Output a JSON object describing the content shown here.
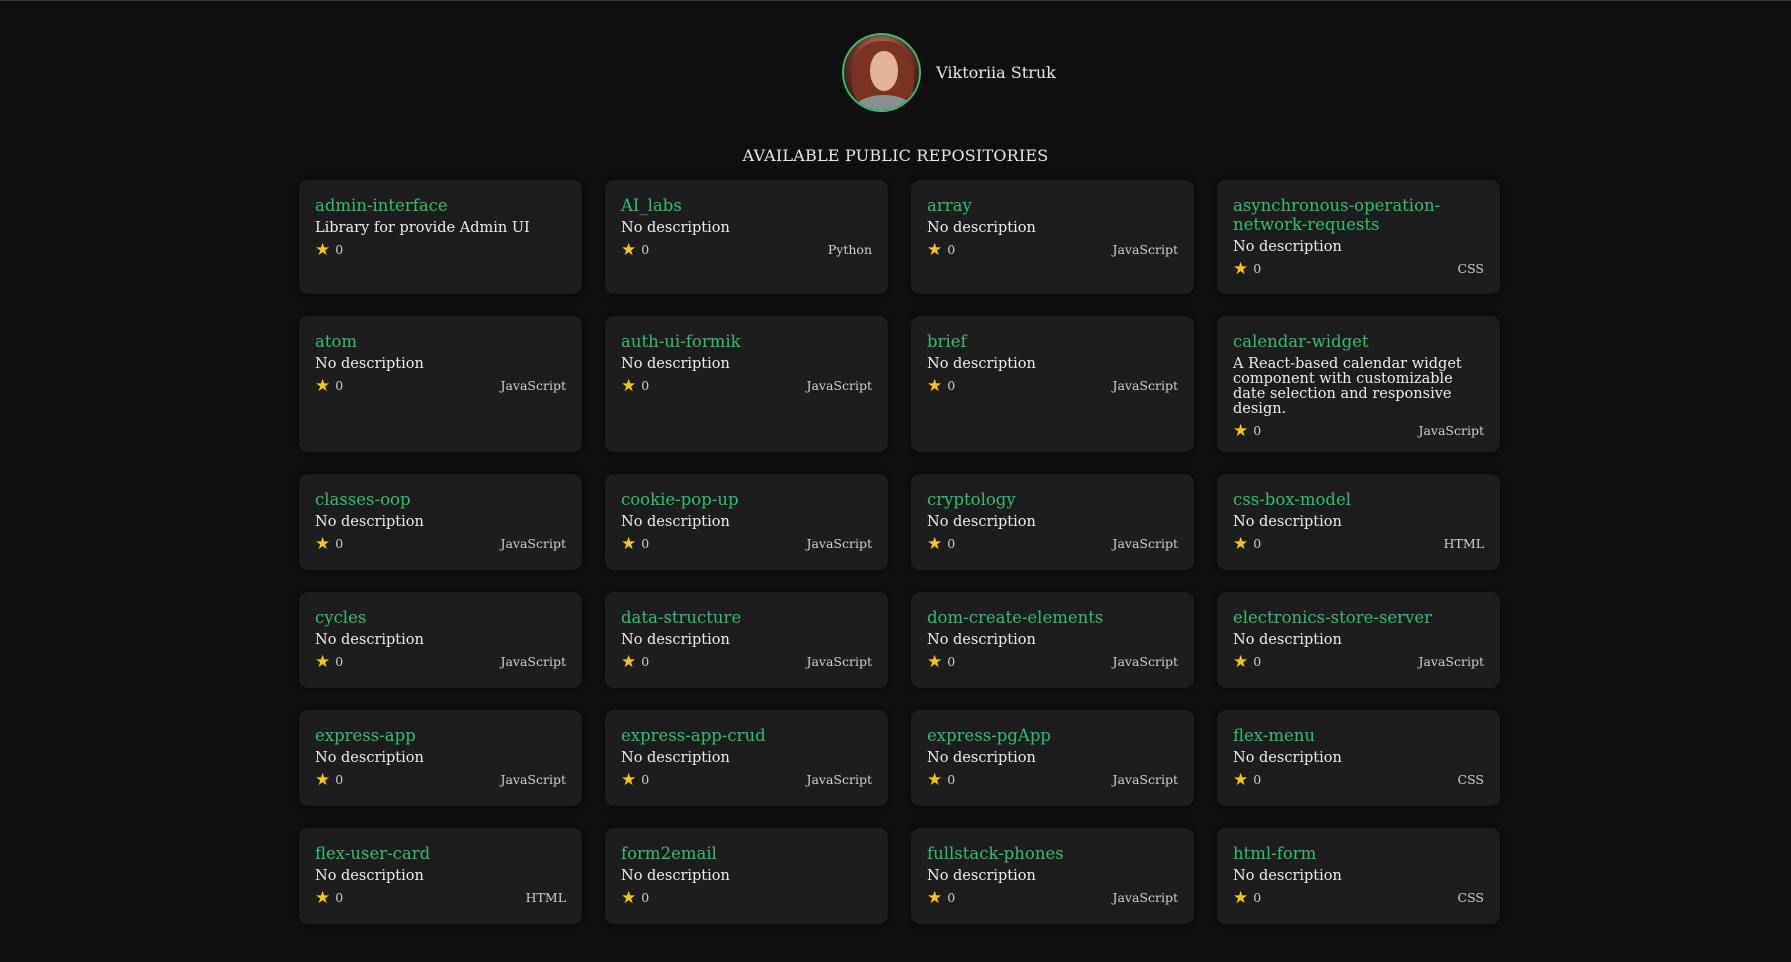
{
  "profile": {
    "name": "Viktoriia Struk"
  },
  "section_title": "AVAILABLE PUBLIC REPOSITORIES",
  "colors": {
    "background": "#0f0f0f",
    "card": "#1d1d1d",
    "accent": "#2fbf71",
    "star": "#f5c518"
  },
  "repos": [
    {
      "name": "admin-interface",
      "description": "Library for provide Admin UI",
      "stars": "0",
      "language": ""
    },
    {
      "name": "AI_labs",
      "description": "No description",
      "stars": "0",
      "language": "Python"
    },
    {
      "name": "array",
      "description": "No description",
      "stars": "0",
      "language": "JavaScript"
    },
    {
      "name": "asynchronous-operation-network-requests",
      "description": "No description",
      "stars": "0",
      "language": "CSS"
    },
    {
      "name": "atom",
      "description": "No description",
      "stars": "0",
      "language": "JavaScript"
    },
    {
      "name": "auth-ui-formik",
      "description": "No description",
      "stars": "0",
      "language": "JavaScript"
    },
    {
      "name": "brief",
      "description": "No description",
      "stars": "0",
      "language": "JavaScript"
    },
    {
      "name": "calendar-widget",
      "description": "A React-based calendar widget component with customizable date selection and responsive design.",
      "stars": "0",
      "language": "JavaScript"
    },
    {
      "name": "classes-oop",
      "description": "No description",
      "stars": "0",
      "language": "JavaScript"
    },
    {
      "name": "cookie-pop-up",
      "description": "No description",
      "stars": "0",
      "language": "JavaScript"
    },
    {
      "name": "cryptology",
      "description": "No description",
      "stars": "0",
      "language": "JavaScript"
    },
    {
      "name": "css-box-model",
      "description": "No description",
      "stars": "0",
      "language": "HTML"
    },
    {
      "name": "cycles",
      "description": "No description",
      "stars": "0",
      "language": "JavaScript"
    },
    {
      "name": "data-structure",
      "description": "No description",
      "stars": "0",
      "language": "JavaScript"
    },
    {
      "name": "dom-create-elements",
      "description": "No description",
      "stars": "0",
      "language": "JavaScript"
    },
    {
      "name": "electronics-store-server",
      "description": "No description",
      "stars": "0",
      "language": "JavaScript"
    },
    {
      "name": "express-app",
      "description": "No description",
      "stars": "0",
      "language": "JavaScript"
    },
    {
      "name": "express-app-crud",
      "description": "No description",
      "stars": "0",
      "language": "JavaScript"
    },
    {
      "name": "express-pgApp",
      "description": "No description",
      "stars": "0",
      "language": "JavaScript"
    },
    {
      "name": "flex-menu",
      "description": "No description",
      "stars": "0",
      "language": "CSS"
    },
    {
      "name": "flex-user-card",
      "description": "No description",
      "stars": "0",
      "language": "HTML"
    },
    {
      "name": "form2email",
      "description": "No description",
      "stars": "0",
      "language": ""
    },
    {
      "name": "fullstack-phones",
      "description": "No description",
      "stars": "0",
      "language": "JavaScript"
    },
    {
      "name": "html-form",
      "description": "No description",
      "stars": "0",
      "language": "CSS"
    }
  ]
}
